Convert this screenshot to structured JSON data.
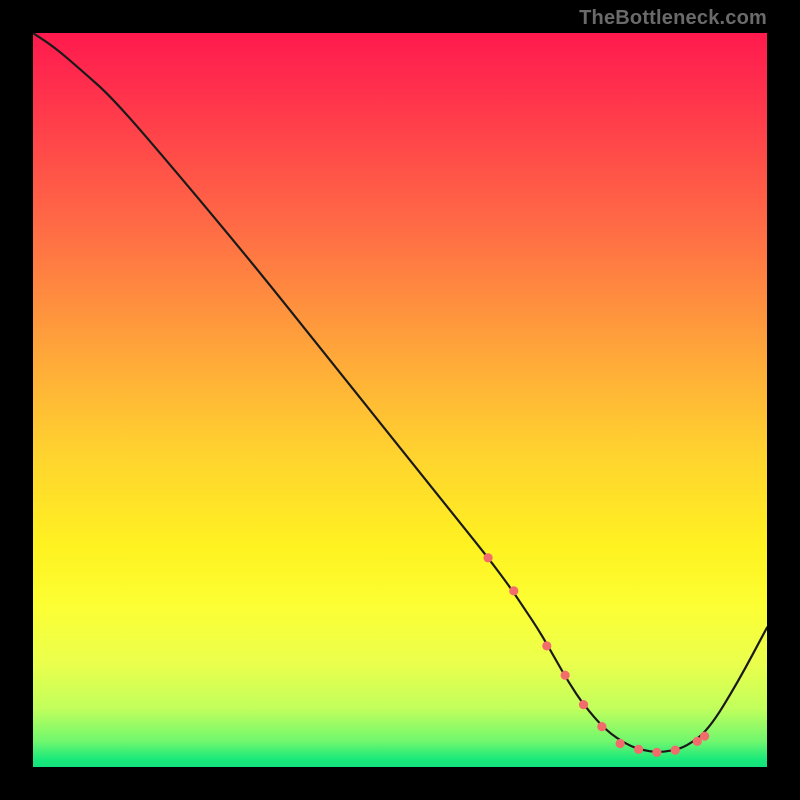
{
  "watermark": "TheBottleneck.com",
  "colors": {
    "background": "#000000",
    "curve_stroke": "#1a1a1a",
    "marker_fill": "#f26c6c",
    "marker_stroke": "#a04040"
  },
  "chart_data": {
    "type": "line",
    "title": "",
    "xlabel": "",
    "ylabel": "",
    "xlim": [
      0,
      100
    ],
    "ylim": [
      0,
      100
    ],
    "grid": false,
    "legend": false,
    "annotations": [],
    "series": [
      {
        "name": "curve",
        "x": [
          0,
          3,
          6.5,
          11,
          20,
          30,
          40,
          50,
          58,
          62,
          65,
          67,
          69,
          71,
          73,
          75,
          78,
          81,
          83,
          85,
          87,
          89,
          92,
          96,
          100
        ],
        "y": [
          100,
          98,
          95,
          91,
          80.5,
          68.5,
          56,
          43.5,
          33.5,
          28.5,
          24.5,
          21.5,
          18.5,
          15,
          11.5,
          8.5,
          5,
          3,
          2.3,
          2,
          2.2,
          2.8,
          5,
          11.5,
          19
        ],
        "markers_x": [
          62,
          65.5,
          70,
          72.5,
          75,
          77.5,
          80,
          82.5,
          85,
          87.5,
          90.5,
          91.5
        ],
        "markers_y": [
          28.5,
          24,
          16.5,
          12.5,
          8.5,
          5.5,
          3.2,
          2.4,
          2,
          2.3,
          3.5,
          4.2
        ]
      }
    ]
  }
}
